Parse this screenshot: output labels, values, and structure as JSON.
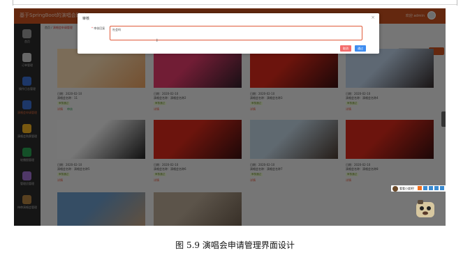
{
  "app": {
    "title": "基于SpringBoot的演唱会网站",
    "welcome": "欢迎 admin"
  },
  "breadcrumb": {
    "home": "首页",
    "current": "演唱会申请管理"
  },
  "sidebar": {
    "items": [
      {
        "label": "首页",
        "icon": "home-icon",
        "color": "#9a9a9a",
        "active": false
      },
      {
        "label": "订单管理",
        "icon": "orders-icon",
        "color": "#cfcfcf",
        "active": false
      },
      {
        "label": "操作日志管理",
        "icon": "log-icon",
        "color": "#3a6fd0",
        "active": false
      },
      {
        "label": "演唱会申请管理",
        "icon": "apps-icon",
        "color": "#3a6fd0",
        "active": true
      },
      {
        "label": "演唱会购票管理",
        "icon": "ticket-icon",
        "color": "#f0b020",
        "active": false
      },
      {
        "label": "轮播图管理",
        "icon": "carousel-icon",
        "color": "#28a050",
        "active": false
      },
      {
        "label": "管理员管理",
        "icon": "user-icon",
        "color": "#a070d0",
        "active": false
      },
      {
        "label": "待审演唱会管理",
        "icon": "audit-icon",
        "color": "#b08040",
        "active": false
      }
    ]
  },
  "cards": [
    {
      "date": "日期：2020-02-10",
      "meta": "演唱会名称：11",
      "status": "审核通过",
      "op": "详情",
      "op2": "审核",
      "colors": [
        "#f6d9b0",
        "#e8a060"
      ]
    },
    {
      "date": "日期：2020-02-10",
      "meta": "演唱会名称：演唱会名称2",
      "status": "审核通过",
      "op": "详情",
      "colors": [
        "#e23a6a",
        "#30202a"
      ]
    },
    {
      "date": "日期：2020-02-10",
      "meta": "演唱会名称：演唱会名称3",
      "status": "审核通过",
      "op": "详情",
      "colors": [
        "#d8291a",
        "#3a1010"
      ]
    },
    {
      "date": "日期：2020-02-10",
      "meta": "演唱会名称：演唱会名称4",
      "status": "审核通过",
      "op": "详情",
      "colors": [
        "#bcd0e6",
        "#332a2a"
      ]
    },
    {
      "date": "日期：2020-02-10",
      "meta": "演唱会名称：演唱会名称5",
      "status": "审核通过",
      "op": "详情",
      "colors": [
        "#eeeeee",
        "#222222"
      ]
    },
    {
      "date": "日期：2020-02-10",
      "meta": "演唱会名称：演唱会名称6",
      "status": "审核通过",
      "op": "详情",
      "colors": [
        "#d8291a",
        "#3a1010"
      ]
    },
    {
      "date": "日期：2020-02-10",
      "meta": "演唱会名称：演唱会名称7",
      "status": "审核通过",
      "op": "详情",
      "colors": [
        "#bfd2e0",
        "#4a3a30"
      ]
    },
    {
      "date": "日期：2020-02-10",
      "meta": "演唱会名称：演唱会名称8",
      "status": "审核通过",
      "op": "详情",
      "colors": [
        "#d8291a",
        "#3a1010"
      ]
    },
    {
      "date": "",
      "meta": "",
      "status": "",
      "op": "",
      "colors": [
        "#6a9ac8",
        "#c9a27a"
      ]
    },
    {
      "date": "",
      "meta": "",
      "status": "",
      "op": "",
      "colors": [
        "#b8a894",
        "#6a5a4a"
      ]
    }
  ],
  "dialog": {
    "title": "审核",
    "field_label": "审核回复",
    "field_value": "社会吗",
    "cancel": "取消",
    "confirm": "通过"
  },
  "float_widget": {
    "text": "看看小度吧!"
  },
  "caption": "图 5.9  演唱会申请管理界面设计"
}
